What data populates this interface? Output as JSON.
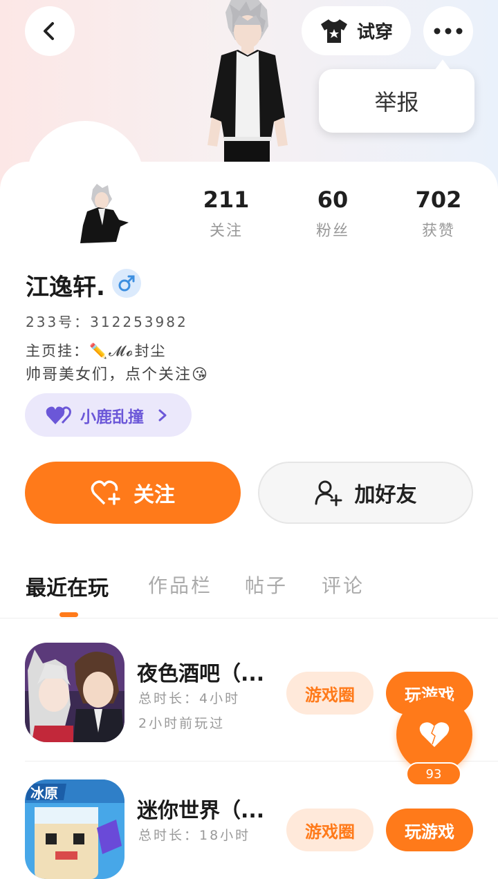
{
  "header": {
    "back_icon": "chevron-left-icon",
    "try_on_label": "试穿",
    "try_on_icon": "tshirt-icon",
    "more_icon": "more-dots-icon",
    "report_label": "举报"
  },
  "profile": {
    "stats": [
      {
        "value": "211",
        "label": "关注"
      },
      {
        "value": "60",
        "label": "粉丝"
      },
      {
        "value": "702",
        "label": "获赞"
      }
    ],
    "name": "江逸轩.",
    "gender_icon": "male-icon",
    "id_line": "233号：312253982",
    "bio_line1": "主页挂：✏️𝓜𝓸封尘",
    "bio_line2": "帅哥美女们，点个关注😘",
    "tag_label": "小鹿乱撞",
    "tag_icon": "heart-icon"
  },
  "actions": {
    "follow_label": "关注",
    "add_friend_label": "加好友"
  },
  "tabs": [
    {
      "label": "最近在玩",
      "active": true
    },
    {
      "label": "作品栏",
      "active": false
    },
    {
      "label": "帖子",
      "active": false
    },
    {
      "label": "评论",
      "active": false
    }
  ],
  "games": [
    {
      "title": "夜色酒吧（...",
      "total_time": "总时长：4小时",
      "last_played": "2小时前玩过",
      "circle_label": "游戏圈",
      "play_label": "玩游戏"
    },
    {
      "title": "迷你世界（...",
      "total_time": "总时长：18小时",
      "circle_label": "游戏圈",
      "play_label": "玩游戏"
    }
  ],
  "fab": {
    "count": "93",
    "icon": "heart-icon"
  },
  "colors": {
    "accent": "#ff7a1a",
    "tag": "#6b57d8",
    "gender": "#3d8fe0"
  }
}
